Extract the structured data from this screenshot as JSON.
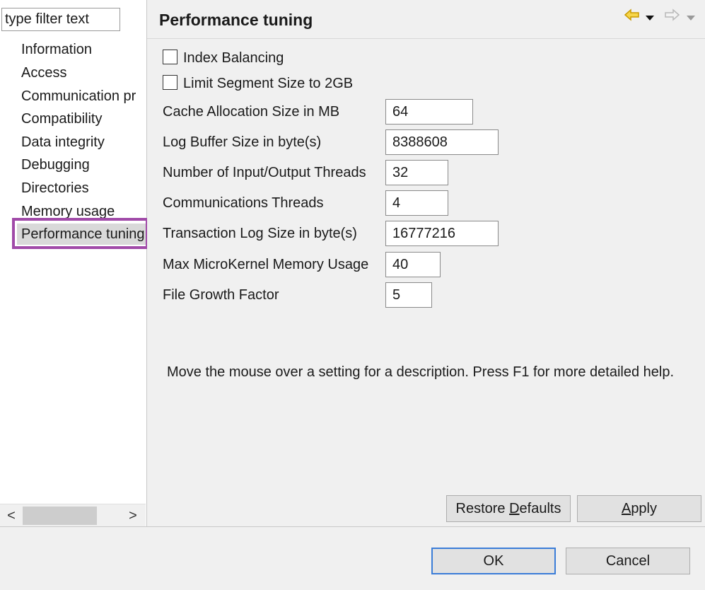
{
  "filter": {
    "placeholder": "type filter text"
  },
  "tree": {
    "items": [
      {
        "label": "Information"
      },
      {
        "label": "Access"
      },
      {
        "label": "Communication pr"
      },
      {
        "label": "Compatibility"
      },
      {
        "label": "Data integrity"
      },
      {
        "label": "Debugging"
      },
      {
        "label": "Directories"
      },
      {
        "label": "Memory usage"
      },
      {
        "label": "Performance tuning"
      }
    ],
    "selected": "Performance tuning"
  },
  "scrollbar": {
    "left_arrow": "<",
    "right_arrow": ">"
  },
  "page": {
    "title": "Performance tuning",
    "nav": {
      "back_icon": "back-arrow-icon",
      "forward_icon": "forward-arrow-icon"
    },
    "checkboxes": [
      {
        "label": "Index Balancing",
        "checked": false
      },
      {
        "label": "Limit Segment Size to 2GB",
        "checked": false
      }
    ],
    "fields": [
      {
        "label": "Cache Allocation Size in MB",
        "value": "64"
      },
      {
        "label": "Log Buffer Size in byte(s)",
        "value": "8388608"
      },
      {
        "label": "Number of Input/Output Threads",
        "value": "32"
      },
      {
        "label": "Communications Threads",
        "value": "4"
      },
      {
        "label": "Transaction Log Size in byte(s)",
        "value": "16777216"
      },
      {
        "label": "Max MicroKernel Memory Usage",
        "value": "40"
      },
      {
        "label": "File Growth Factor",
        "value": "5"
      }
    ],
    "help_text": "Move the mouse over a setting for a description. Press F1 for more detailed help.",
    "buttons": {
      "restore_pre": "Restore ",
      "restore_mnemonic": "D",
      "restore_post": "efaults",
      "apply_mnemonic": "A",
      "apply_post": "pply"
    }
  },
  "dialog": {
    "ok_label": "OK",
    "cancel_label": "Cancel"
  },
  "colors": {
    "highlight_border": "#a04aa8",
    "selection_bg": "#d9d9d9",
    "default_button_border": "#3b7dd8",
    "nav_back": "#e8b800"
  }
}
